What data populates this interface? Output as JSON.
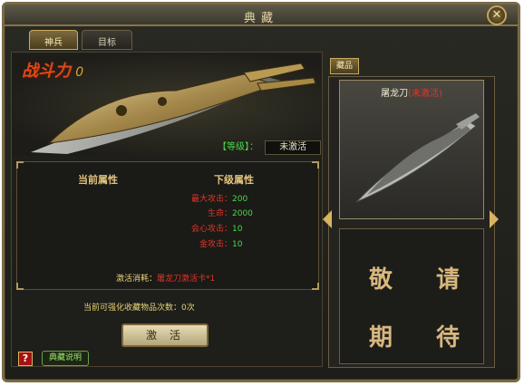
{
  "window": {
    "title": "典藏",
    "close_icon": "close-icon"
  },
  "tabs": [
    {
      "label": "神兵",
      "active": true
    },
    {
      "label": "目标",
      "active": false
    }
  ],
  "weapon": {
    "power_label": "战斗力",
    "power_value": "0",
    "level_label": "【等级】：",
    "level_value": "未激活"
  },
  "attributes": {
    "current_header": "当前属性",
    "next_header": "下级属性",
    "rows": [
      {
        "key": "最大攻击：",
        "value": "200"
      },
      {
        "key": "生命：",
        "value": "2000"
      },
      {
        "key": "会心攻击：",
        "value": "10"
      },
      {
        "key": "金攻击：",
        "value": "10"
      }
    ],
    "cost_label": "激活消耗：",
    "cost_value": "屠龙刀激活卡*1"
  },
  "enhance_times": "当前可强化收藏物品次数：0次",
  "activate_button": "激活",
  "help": {
    "icon": "question-icon",
    "link_label": "典藏说明"
  },
  "right_panel": {
    "tab_label": "藏品",
    "item_name": "屠龙刀",
    "item_status": "(未激活)",
    "coming_soon": [
      "敬",
      "请",
      "期",
      "待"
    ]
  },
  "colors": {
    "gold": "#d8b460",
    "red": "#e0352a",
    "green": "#4cd84a",
    "frame": "#7a6a45"
  }
}
